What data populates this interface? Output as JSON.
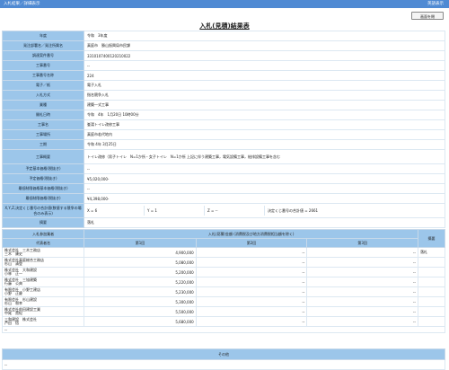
{
  "header": {
    "title": "入札結果／詳細表示",
    "right_label": "英語表示"
  },
  "back_button": "画面を閉",
  "page_title": "入札(見積)結果表",
  "info": [
    {
      "label": "年度",
      "value": "令和　3年度"
    },
    {
      "label": "発注部署名／発注所属名",
      "value": "真庭市　勝山振興局市民課"
    },
    {
      "label": "調達案件番号",
      "value": "3310107400120210022"
    },
    {
      "label": "工事番号",
      "value": "--"
    },
    {
      "label": "工事番号名称",
      "value": "224"
    },
    {
      "label": "電子／紙",
      "value": "電子入札"
    },
    {
      "label": "入札方式",
      "value": "指名競争入札"
    },
    {
      "label": "業種",
      "value": "建築一式工事"
    },
    {
      "label": "開札日時",
      "value": "令和　4年　1月20日 10時00分"
    },
    {
      "label": "工事名",
      "value": "峯湯トイレ改修工事"
    },
    {
      "label": "工事場所",
      "value": "真庭市若代地内"
    },
    {
      "label": "工期",
      "value": "令和 4年 3月25日"
    },
    {
      "label": "工事概要",
      "value": "トイレ改修（男子トイレ　N=1か所・女子トイレ　N=1か所 上記に伴う建築工事，電気設備工事，給排設備工事を含む"
    },
    {
      "label": "予定基本価格(税抜き)",
      "value": "--"
    },
    {
      "label": "予定価格(税抜き)",
      "value": "¥5,020,000-"
    },
    {
      "label": "最低制限価格基本価格(税抜き)",
      "value": "--"
    },
    {
      "label": "最低制限価格(税抜き)",
      "value": "¥4,398,000-"
    }
  ],
  "formula": {
    "label": "X,Y,Z,決定くじ番号の合計値(数値する競争の場合のみ表示)",
    "x": "X = 6",
    "y": "Y = 1",
    "z": "Z = --",
    "total": "決定くじ番号の合計値 = 2661"
  },
  "remarks": {
    "label": "摘要",
    "value": "落札"
  },
  "bid_table": {
    "h_company": "入札参加業者",
    "h_amounts": "入札(見積)金額 (消費税及び地方消費税相当額を除く)",
    "h_note": "摘要",
    "h_rep": "代表者名",
    "h_r1": "第1回",
    "h_r2": "第2回",
    "h_r3": "第3回",
    "rows": [
      {
        "company": "株式会社　三木工務店",
        "rep": "三木　康史",
        "r1": "4,900,000",
        "r2": "--",
        "r3": "--",
        "note": "落札"
      },
      {
        "company": "株式会社真庭総合工務店",
        "rep": "杉山　清登",
        "r1": "5,080,000",
        "r2": "--",
        "r3": "--",
        "note": ""
      },
      {
        "company": "株式会社　大和建設",
        "rep": "小林　正一",
        "r1": "5,200,000",
        "r2": "--",
        "r3": "--",
        "note": ""
      },
      {
        "company": "株式会社　三協建築",
        "rep": "行藤　公典",
        "r1": "5,220,000",
        "r2": "--",
        "r3": "--",
        "note": ""
      },
      {
        "company": "有限会社　小野工建店",
        "rep": "小野　正慶",
        "r1": "5,230,000",
        "r2": "--",
        "r3": "--",
        "note": ""
      },
      {
        "company": "有限会社　杉山建設",
        "rep": "杉山　和幸",
        "r1": "5,300,000",
        "r2": "--",
        "r3": "--",
        "note": ""
      },
      {
        "company": "株式会社前田建設工業",
        "rep": "中尾　貴紀",
        "r1": "5,500,000",
        "r2": "--",
        "r3": "--",
        "note": ""
      },
      {
        "company": "三和建設　株式会社",
        "rep": "芦田　悟",
        "r1": "5,680,000",
        "r2": "--",
        "r3": "--",
        "note": ""
      }
    ],
    "empty_row": "--"
  },
  "other": {
    "title": "その他",
    "value": "--"
  }
}
